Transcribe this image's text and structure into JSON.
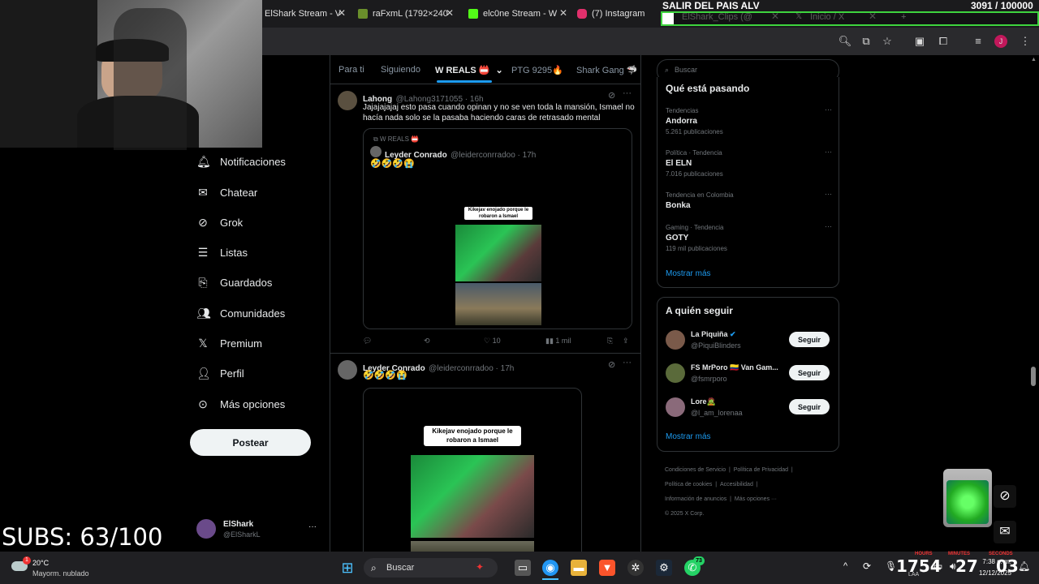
{
  "browser": {
    "tabs": [
      {
        "label": "ElShark Stream - V",
        "color": "#9146ff"
      },
      {
        "label": "raFxmL (1792×240",
        "color": "#6a8f2b"
      },
      {
        "label": "elc0ne Stream - W",
        "color": "#53fc18"
      },
      {
        "label": "(7) Instagram",
        "color": "#e1306c"
      },
      {
        "label": "ElShark_Clips (@",
        "color": "#1da1f2"
      },
      {
        "label": "Inicio / X",
        "color": "#ffffff"
      }
    ]
  },
  "stream_overlay": {
    "goal_title": "SALIR DEL PAIS ALV",
    "goal_count": "3091 / 100000",
    "goal_progress": 0.031,
    "subs": "SUBS: 63/100",
    "timer": {
      "hours": "1754",
      "minutes": "27",
      "seconds": "03",
      "hours_label": "HOURS",
      "minutes_label": "MINUTES",
      "seconds_label": "SECONDS"
    }
  },
  "sidebar": {
    "items": [
      {
        "label": "Notificaciones",
        "icon": "bell-icon"
      },
      {
        "label": "Chatear",
        "icon": "mail-icon"
      },
      {
        "label": "Grok",
        "icon": "grok-icon"
      },
      {
        "label": "Listas",
        "icon": "list-icon"
      },
      {
        "label": "Guardados",
        "icon": "bookmark-icon"
      },
      {
        "label": "Comunidades",
        "icon": "people-icon"
      },
      {
        "label": "Premium",
        "icon": "x-logo-icon"
      },
      {
        "label": "Perfil",
        "icon": "person-icon"
      },
      {
        "label": "Más opciones",
        "icon": "more-circle-icon"
      }
    ],
    "post_button": "Postear",
    "account": {
      "name": "ElShark",
      "handle": "@ElSharkL",
      "more": "···"
    }
  },
  "feed": {
    "tabs": [
      "Para ti",
      "Siguiendo",
      "W REALS 📛",
      "PTG 9295🔥",
      "Shark Gang 🦈"
    ],
    "active_tab": 2,
    "tweet1": {
      "name": "Lahong",
      "handle": "@Lahong3171055 · 16h",
      "text_line1": "Jajajajajaj esto pasa cuando opinan y no se ven toda la mansión, Ismael no",
      "text_line2": "hacía nada solo se la pasaba haciendo caras de retrasado mental",
      "quote": {
        "community": "W REALS 📛",
        "name": "Leyder Conrado",
        "handle": "@leiderconrradoo · 17h",
        "text": "🤣🤣🤣😭",
        "video_caption": "Kikejav enojado porque le robaron a Ismael"
      },
      "actions": {
        "replies": "",
        "retweets": "",
        "likes": "10",
        "views": "1 mil"
      }
    },
    "tweet2": {
      "name": "Leyder Conrado",
      "handle": "@leiderconrradoo · 17h",
      "text": "🤣🤣🤣😭",
      "video_caption": "Kikejav enojado porque le robaron a Ismael"
    }
  },
  "right": {
    "search_placeholder": "Buscar",
    "trends_title": "Qué está pasando",
    "trends": [
      {
        "meta": "Tendencias",
        "title": "Andorra",
        "count": "5.261 publicaciones"
      },
      {
        "meta": "Política · Tendencia",
        "title": "El ELN",
        "count": "7.016 publicaciones"
      },
      {
        "meta": "Tendencia en Colombia",
        "title": "Bonka",
        "count": ""
      },
      {
        "meta": "Gaming · Tendencia",
        "title": "GOTY",
        "count": "119 mil publicaciones"
      }
    ],
    "show_more": "Mostrar más",
    "follow_title": "A quién seguir",
    "follow": [
      {
        "name": "La Piquiña",
        "handle": "@PiquiBlinders",
        "button": "Seguir"
      },
      {
        "name": "FS MrPoro 🇨🇴 Van Gam...",
        "handle": "@fsmrporo",
        "button": "Seguir"
      },
      {
        "name": "Lore🧟",
        "handle": "@l_am_lorenaa",
        "button": "Seguir"
      }
    ],
    "follow_more": "Mostrar más",
    "footer": [
      "Condiciones de Servicio",
      "Política de Privacidad",
      "Política de cookies",
      "Accesibilidad",
      "Información de anuncios",
      "Más opciones ···",
      "© 2025 X Corp."
    ]
  },
  "taskbar": {
    "weather_temp": "20°C",
    "weather_desc": "Mayorm. nublado",
    "search": "Buscar",
    "time": "7:38 p. m.",
    "date": "12/12/2025",
    "whatsapp_badge": "73",
    "lang": "LAA"
  },
  "colors": {
    "accent": "#1d9bf0",
    "goal_bar": "#3ed43e",
    "background": "#000000"
  }
}
